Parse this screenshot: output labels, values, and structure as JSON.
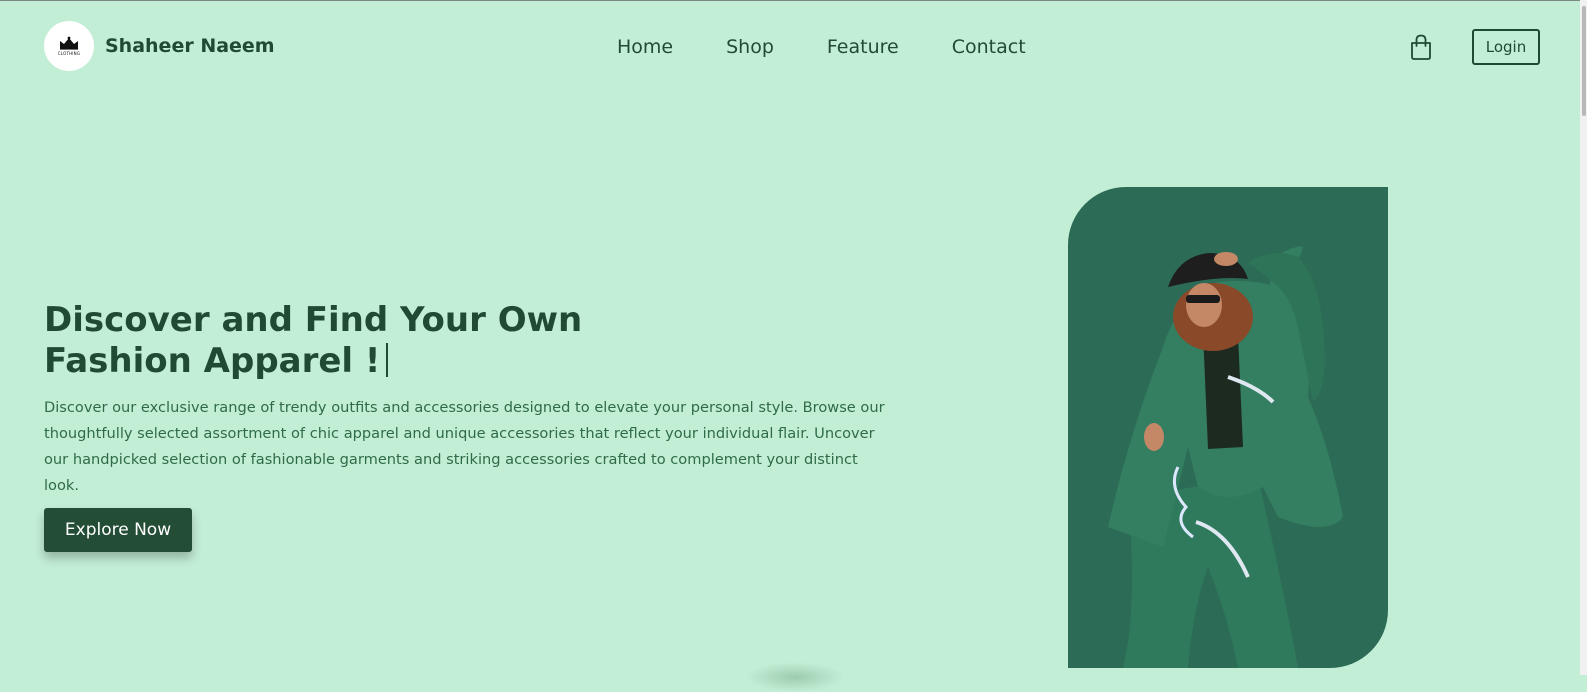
{
  "brand": {
    "name": "Shaheer Naeem",
    "logo_text": "CLOTHING"
  },
  "nav": {
    "links": [
      "Home",
      "Shop",
      "Feature",
      "Contact"
    ],
    "login_label": "Login",
    "bag_icon": "shopping-bag-icon"
  },
  "hero": {
    "title_line1": "Discover and Find Your Own",
    "title_line2": "Fashion Apparel !",
    "description": "Discover our exclusive range of trendy outfits and accessories designed to elevate your personal style. Browse our thoughtfully selected assortment of chic apparel and unique accessories that reflect your individual flair. Uncover our handpicked selection of fashionable garments and striking accessories crafted to complement your distinct look.",
    "cta_label": "Explore Now"
  },
  "colors": {
    "background": "#c3eed6",
    "primary": "#244d35",
    "card": "#2c6b55"
  }
}
